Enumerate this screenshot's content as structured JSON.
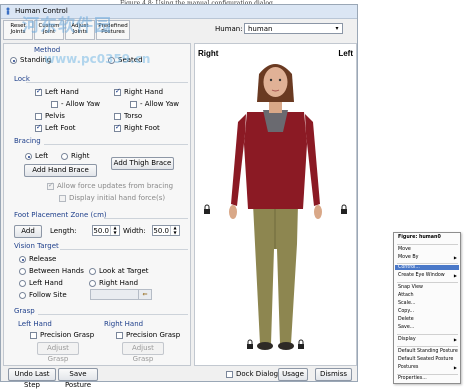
{
  "page_caption": "Figure 4.8: Using the manual configuration dialog",
  "watermark": {
    "line1": "河东软件园",
    "line2": "www.pc0359.cn"
  },
  "window": {
    "title": "Human Control"
  },
  "toolbar": {
    "buttons": [
      {
        "label": "Reset Joints"
      },
      {
        "label": "Custom Joint"
      },
      {
        "label": "Adjust Joints"
      },
      {
        "label": "Predefined Postures"
      }
    ]
  },
  "human_select": {
    "label": "Human:",
    "value": "human"
  },
  "sections": {
    "method": {
      "title": "Method",
      "standing": "Standing",
      "seated": "Seated"
    },
    "lock": {
      "title": "Lock",
      "left_hand": "Left Hand",
      "right_hand": "Right Hand",
      "allow_yaw_left": "- Allow Yaw",
      "allow_yaw_right": "- Allow Yaw",
      "pelvis": "Pelvis",
      "torso": "Torso",
      "left_foot": "Left Foot",
      "right_foot": "Right Foot"
    },
    "bracing": {
      "title": "Bracing",
      "left": "Left",
      "right": "Right",
      "add_hand_brace": "Add Hand Brace",
      "add_thigh_brace": "Add Thigh Brace",
      "allow_force_updates": "Allow force updates from bracing",
      "display_initial": "Display initial hand force(s)"
    },
    "foot": {
      "title": "Foot Placement Zone (cm)",
      "add": "Add",
      "length_label": "Length:",
      "length_value": "50.0",
      "width_label": "Width:",
      "width_value": "50.0"
    },
    "vision": {
      "title": "Vision Target",
      "release": "Release",
      "between_hands": "Between Hands",
      "look_at_target": "Look at Target",
      "left_hand": "Left Hand",
      "right_hand": "Right Hand",
      "follow_site": "Follow Site"
    },
    "grasp": {
      "title": "Grasp",
      "left_hand": "Left Hand",
      "right_hand": "Right Hand",
      "precision_left": "Precision Grasp",
      "precision_right": "Precision Grasp",
      "adjust_left": "Adjust Grasp",
      "adjust_right": "Adjust Grasp"
    }
  },
  "viewport": {
    "right_label": "Right",
    "left_label": "Left"
  },
  "bottom": {
    "undo": "Undo Last Step",
    "save_posture": "Save Posture",
    "dock_dialog": "Dock Dialog",
    "usage": "Usage",
    "dismiss": "Dismiss"
  },
  "context_menu": {
    "header": "Figure: human0",
    "items": [
      {
        "label": "Move",
        "arrow": false
      },
      {
        "label": "Move By",
        "arrow": true
      },
      {
        "label": "Control...",
        "arrow": false,
        "selected": true
      },
      {
        "label": "Create Eye Window",
        "arrow": true
      },
      {
        "label": "Snap View",
        "arrow": false
      },
      {
        "label": "Attach",
        "arrow": false
      },
      {
        "label": "Scale...",
        "arrow": false
      },
      {
        "label": "Copy...",
        "arrow": false
      },
      {
        "label": "Delete",
        "arrow": false
      },
      {
        "label": "Save...",
        "arrow": false
      },
      {
        "label": "Display",
        "arrow": true
      },
      {
        "label": "Default Standing Posture",
        "arrow": false
      },
      {
        "label": "Default Seated Posture",
        "arrow": false
      },
      {
        "label": "Postures",
        "arrow": true
      },
      {
        "label": "Properties...",
        "arrow": false
      }
    ]
  },
  "colors": {
    "section_title": "#1e3f8b",
    "shirt": "#8b1a24",
    "pants": "#8d8650",
    "menu_highlight": "#4a78c8"
  }
}
